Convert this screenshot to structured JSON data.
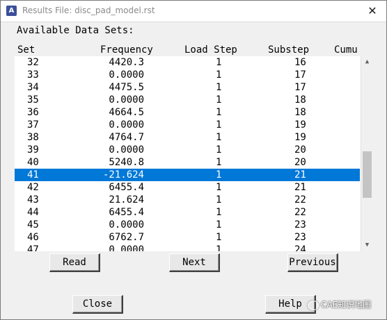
{
  "window": {
    "title": "Results File: disc_pad_model.rst",
    "app_icon_letter": "A",
    "close_symbol": "✕"
  },
  "section_label": "Available Data Sets:",
  "columns": [
    "Set",
    "Frequency",
    "Load Step",
    "Substep",
    "Cumu"
  ],
  "rows": [
    {
      "set": "32",
      "freq": "4420.3",
      "load": "1",
      "sub": "16"
    },
    {
      "set": "33",
      "freq": "0.0000",
      "load": "1",
      "sub": "17"
    },
    {
      "set": "34",
      "freq": "4475.5",
      "load": "1",
      "sub": "17"
    },
    {
      "set": "35",
      "freq": "0.0000",
      "load": "1",
      "sub": "18"
    },
    {
      "set": "36",
      "freq": "4664.5",
      "load": "1",
      "sub": "18"
    },
    {
      "set": "37",
      "freq": "0.0000",
      "load": "1",
      "sub": "19"
    },
    {
      "set": "38",
      "freq": "4764.7",
      "load": "1",
      "sub": "19"
    },
    {
      "set": "39",
      "freq": "0.0000",
      "load": "1",
      "sub": "20"
    },
    {
      "set": "40",
      "freq": "5240.8",
      "load": "1",
      "sub": "20"
    },
    {
      "set": "41",
      "freq": "-21.624",
      "load": "1",
      "sub": "21"
    },
    {
      "set": "42",
      "freq": "6455.4",
      "load": "1",
      "sub": "21"
    },
    {
      "set": "43",
      "freq": "21.624",
      "load": "1",
      "sub": "22"
    },
    {
      "set": "44",
      "freq": "6455.4",
      "load": "1",
      "sub": "22"
    },
    {
      "set": "45",
      "freq": "0.0000",
      "load": "1",
      "sub": "23"
    },
    {
      "set": "46",
      "freq": "6762.7",
      "load": "1",
      "sub": "23"
    },
    {
      "set": "47",
      "freq": "0.0000",
      "load": "1",
      "sub": "24"
    }
  ],
  "selected_set": "41",
  "scrollbar": {
    "up_symbol": "▲",
    "down_symbol": "▼"
  },
  "buttons": {
    "read": "Read",
    "next": "Next",
    "previous": "Previous",
    "close": "Close",
    "help": "Help"
  },
  "watermark": "CAE知识地图",
  "colors": {
    "selection": "#0078d7"
  }
}
